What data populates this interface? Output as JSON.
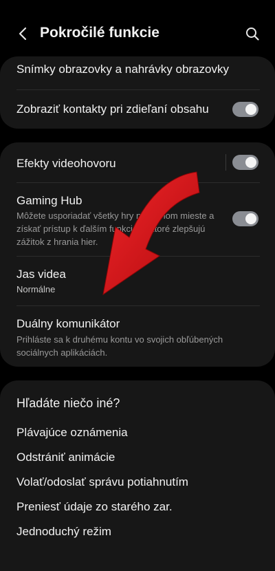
{
  "header": {
    "back_icon": "chevron-left-icon",
    "title": "Pokročilé funkcie",
    "search_icon": "search-icon"
  },
  "card1": {
    "screenshots_label": "Snímky obrazovky a nahrávky obrazovky",
    "show_contacts_label": "Zobraziť kontakty pri zdieľaní obsahu",
    "show_contacts_on": true
  },
  "card2": {
    "video_effects_label": "Efekty videohovoru",
    "video_effects_on": true,
    "gaming_hub_label": "Gaming Hub",
    "gaming_hub_desc": "Môžete usporiadať všetky hry na jednom mieste a získať prístup k ďalším funkciám, ktoré zlepšujú zážitok z hrania hier.",
    "gaming_hub_on": true,
    "video_brightness_label": "Jas videa",
    "video_brightness_value": "Normálne",
    "dual_messenger_label": "Duálny komunikátor",
    "dual_messenger_desc": "Prihláste sa k druhému kontu vo svojich obľúbených sociálnych aplikáciách."
  },
  "card3": {
    "heading": "Hľadáte niečo iné?",
    "links": [
      "Plávajúce oznámenia",
      "Odstrániť animácie",
      "Volať/odoslať správu potiahnutím",
      "Preniesť údaje zo starého zar.",
      "Jednoduchý režim"
    ]
  },
  "colors": {
    "background": "#000000",
    "card": "#171717",
    "toggle_track": "#8a8d93",
    "overlay_arrow": "#d10f12"
  }
}
